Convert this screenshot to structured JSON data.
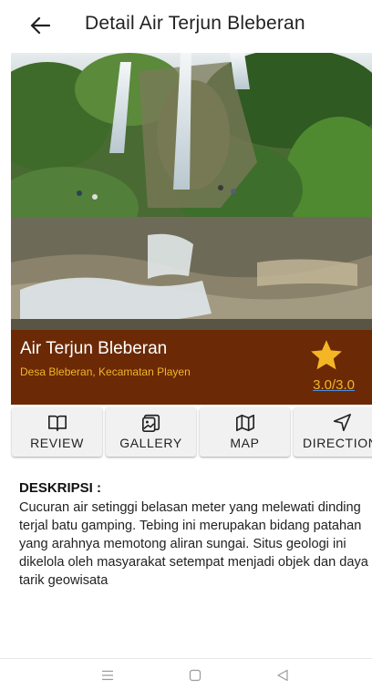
{
  "appbar": {
    "title": "Detail Air Terjun Bleberan",
    "back_icon": "arrow-left-icon"
  },
  "place": {
    "name": "Air Terjun Bleberan",
    "location": "Desa Bleberan, Kecamatan Playen",
    "rating": "3.0/3.0",
    "rating_icon": "star-icon"
  },
  "colors": {
    "band": "#6b2a05",
    "accent": "#f2b42b"
  },
  "actions": [
    {
      "label": "REVIEW",
      "icon": "book-open-icon"
    },
    {
      "label": "GALLERY",
      "icon": "image-icon"
    },
    {
      "label": "MAP",
      "icon": "map-icon"
    },
    {
      "label": "DIRECTION",
      "icon": "navigation-icon"
    }
  ],
  "description": {
    "heading": "DESKRIPSI :",
    "text": "Cucuran air setinggi belasan meter yang melewati dinding terjal batu gamping. Tebing ini merupakan bidang patahan yang arahnya memotong aliran sungai. Situs geologi ini dikelola oleh masyarakat setempat menjadi objek dan daya tarik geowisata"
  },
  "navbar": {
    "items": [
      "menu-icon",
      "home-square-icon",
      "back-triangle-icon"
    ]
  }
}
